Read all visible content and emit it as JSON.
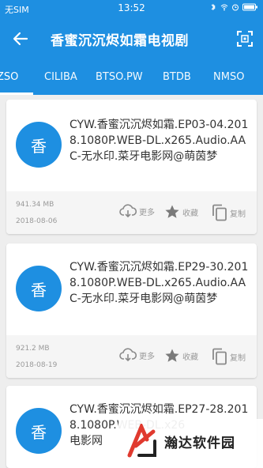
{
  "statusbar": {
    "carrier": "无SIM",
    "time": "13:52"
  },
  "header": {
    "title": "香蜜沉沉烬如霜电视剧"
  },
  "tabs": [
    {
      "label": "ZSO",
      "active": true
    },
    {
      "label": "CILIBA",
      "active": false
    },
    {
      "label": "BTSO.PW",
      "active": false
    },
    {
      "label": "BTDB",
      "active": false
    },
    {
      "label": "NMSO",
      "active": false
    }
  ],
  "actions": {
    "more": "更多",
    "favorite": "收藏",
    "copy": "复制"
  },
  "results": [
    {
      "avatar_char": "香",
      "name": "CYW.香蜜沉沉烬如霜.EP03-04.2018.1080P.WEB-DL.x265.Audio.AAC-无水印.菜牙电影网@萌茵梦",
      "size": "941.34 MB",
      "date": "2018-08-06"
    },
    {
      "avatar_char": "香",
      "name": "CYW.香蜜沉沉烬如霜.EP29-30.2018.1080P.WEB-DL.x265.Audio.AAC-无水印.菜牙电影网@萌茵梦",
      "size": "921.2 MB",
      "date": "2018-08-19"
    },
    {
      "avatar_char": "香",
      "name": "CYW.香蜜沉沉烬如霜.EP27-28.2018.1080P.WEB-DL.x26",
      "name_tail": "电影网"
    }
  ],
  "watermark": {
    "text": "瀚达软件园"
  },
  "colors": {
    "primary": "#1e8fe1",
    "card_footer": "#f5f5f5",
    "muted_text": "#9a9a9a"
  }
}
